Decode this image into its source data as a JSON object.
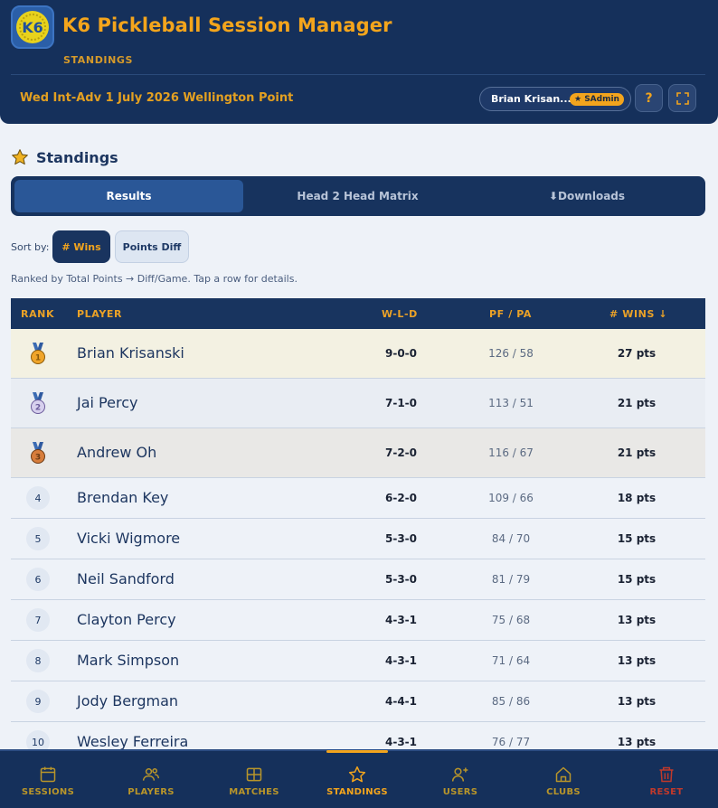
{
  "app": {
    "logo_text": "K6",
    "title": "K6 Pickleball Session Manager",
    "subtitle": "STANDINGS",
    "session": "Wed Int-Adv 1 July 2026 Wellington Point",
    "user_name": "Brian Krisan...",
    "role_badge": "★ SAdmin",
    "help_label": "?",
    "fullscreen_label": "⛶"
  },
  "section": {
    "title": "Standings",
    "icon": "star-icon"
  },
  "tabs": [
    {
      "label": "Results",
      "active": true
    },
    {
      "label": "Head 2 Head Matrix",
      "active": false
    },
    {
      "label": "⬇Downloads",
      "active": false
    }
  ],
  "sort": {
    "label": "Sort by:",
    "options": [
      {
        "label": "# Wins",
        "active": true
      },
      {
        "label": "Points Diff",
        "active": false
      }
    ]
  },
  "note": "Ranked by Total Points → Diff/Game. Tap a row for details.",
  "table": {
    "headers": [
      "RANK",
      "PLAYER",
      "W-L-D",
      "PF / PA",
      "# WINS ↓"
    ],
    "rows": [
      {
        "rank": "1",
        "medal": "gold",
        "player": "Brian Krisanski",
        "wld": "9-0-0",
        "pfpa": "126 / 58",
        "pts": "27 pts"
      },
      {
        "rank": "2",
        "medal": "silver",
        "player": "Jai Percy",
        "wld": "7-1-0",
        "pfpa": "113 / 51",
        "pts": "21 pts"
      },
      {
        "rank": "3",
        "medal": "bronze",
        "player": "Andrew Oh",
        "wld": "7-2-0",
        "pfpa": "116 / 67",
        "pts": "21 pts"
      },
      {
        "rank": "4",
        "player": "Brendan Key",
        "wld": "6-2-0",
        "pfpa": "109 / 66",
        "pts": "18 pts"
      },
      {
        "rank": "5",
        "player": "Vicki Wigmore",
        "wld": "5-3-0",
        "pfpa": "84 / 70",
        "pts": "15 pts"
      },
      {
        "rank": "6",
        "player": "Neil Sandford",
        "wld": "5-3-0",
        "pfpa": "81 / 79",
        "pts": "15 pts"
      },
      {
        "rank": "7",
        "player": "Clayton Percy",
        "wld": "4-3-1",
        "pfpa": "75 / 68",
        "pts": "13 pts"
      },
      {
        "rank": "8",
        "player": "Mark Simpson",
        "wld": "4-3-1",
        "pfpa": "71 / 64",
        "pts": "13 pts"
      },
      {
        "rank": "9",
        "player": "Jody Bergman",
        "wld": "4-4-1",
        "pfpa": "85 / 86",
        "pts": "13 pts"
      },
      {
        "rank": "10",
        "player": "Wesley Ferreira",
        "wld": "4-3-1",
        "pfpa": "76 / 77",
        "pts": "13 pts"
      }
    ]
  },
  "nav": [
    {
      "label": "SESSIONS",
      "icon": "calendar-icon",
      "color": "#b8952a"
    },
    {
      "label": "PLAYERS",
      "icon": "players-icon",
      "color": "#b8952a"
    },
    {
      "label": "MATCHES",
      "icon": "grid-icon",
      "color": "#b8952a"
    },
    {
      "label": "STANDINGS",
      "icon": "star-icon",
      "color": "#f2a41d",
      "active": true
    },
    {
      "label": "USERS",
      "icon": "add-user-icon",
      "color": "#b8952a"
    },
    {
      "label": "CLUBS",
      "icon": "home-icon",
      "color": "#b8952a"
    },
    {
      "label": "RESET",
      "icon": "trash-icon",
      "color": "#c0392b"
    }
  ],
  "colors": {
    "navy": "#15305b",
    "accent": "#f2a41d",
    "gold_row": "#f3f1e2",
    "silver_row": "#e9edf3",
    "bronze_row": "#e9e8e6"
  }
}
